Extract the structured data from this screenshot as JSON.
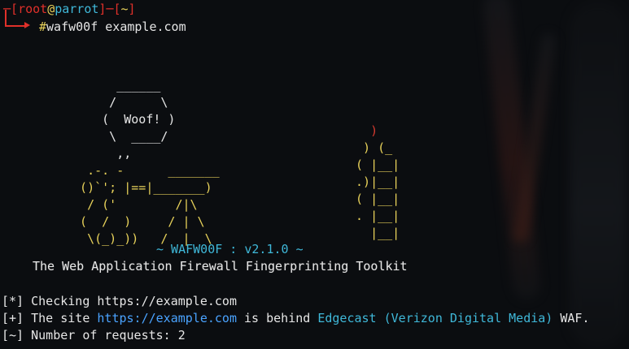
{
  "prompt": {
    "user": "root",
    "at": "@",
    "host": "parrot",
    "open": "─[",
    "close": "]─[",
    "path": "~",
    "end": "]",
    "symbol": "#",
    "command": "wafw00f example.com"
  },
  "banner": {
    "dog_art": [
      "       ______",
      "      /      \\",
      "     (  Woof! )",
      "      \\  ____/",
      "       ,,",
      "   .-. -      _______",
      "  ()`'; |==|_______)",
      "   / ('        /|\\",
      "  (  /  )     / | \\",
      "   \\(_)_))   /  |  \\"
    ],
    "tower_art": [
      "   )",
      "  ) (_",
      " ( |__|",
      " .)|__|",
      " ( |__|",
      " . |__|",
      "   |__|"
    ],
    "version_line": "~ WAFW00F : v2.1.0 ~",
    "tagline": "The Web Application Firewall Fingerprinting Toolkit"
  },
  "output": {
    "checking_prefix": "[*]",
    "checking_text": "Checking https://example.com",
    "found_prefix": "[+]",
    "found_the_site": "The site",
    "found_url": "https://example.com",
    "found_is_behind": "is behind",
    "found_waf": "Edgecast (Verizon Digital Media)",
    "found_suffix": "WAF.",
    "requests_prefix": "[~]",
    "requests_text": "Number of requests: 2"
  },
  "colors": {
    "prompt_red": "#e0302a",
    "art_yellow": "#e8d25a",
    "accent_cyan": "#3fb8d9",
    "link_blue": "#4aa3ff"
  }
}
